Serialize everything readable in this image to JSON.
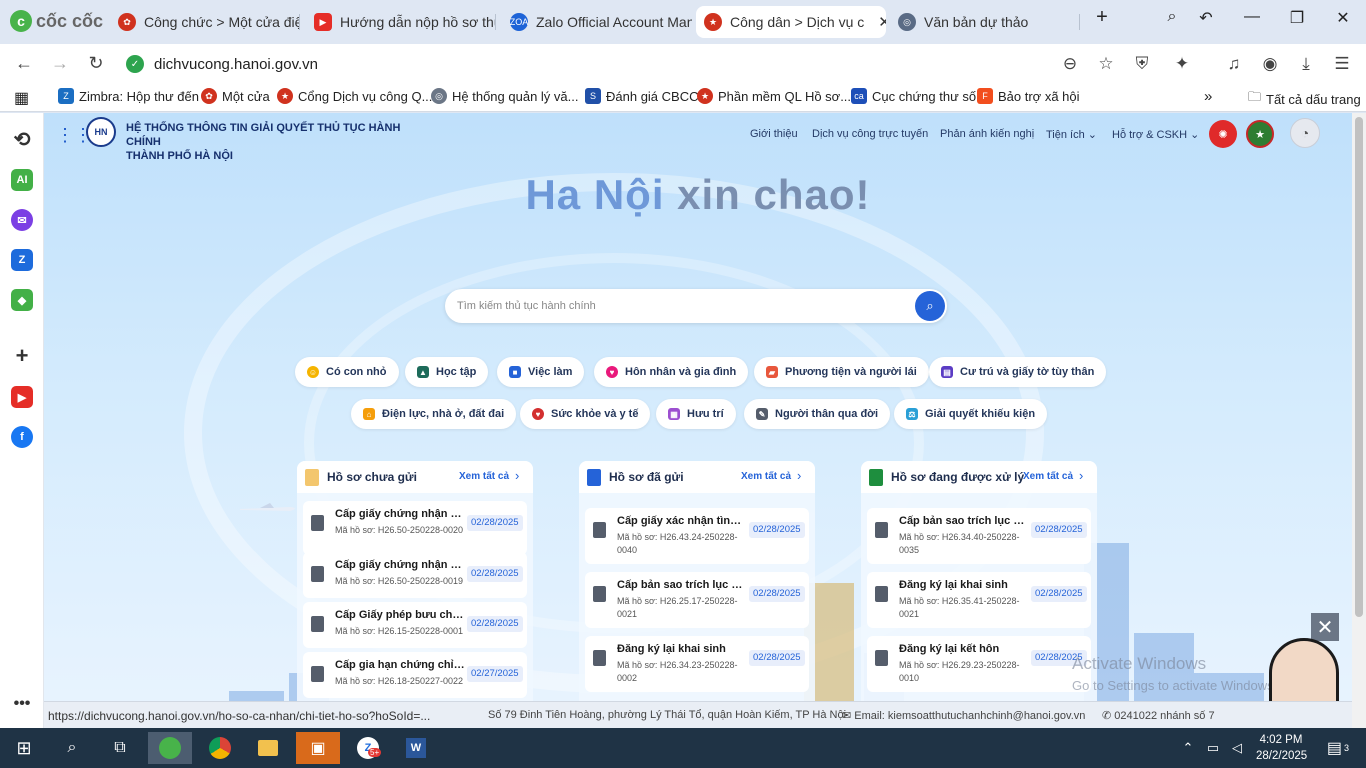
{
  "browser": {
    "brand": "cốc cốc",
    "tabs": [
      {
        "label": "Công chức > Một cửa điện",
        "fav": "hexagon-icon",
        "color": "#d0321e"
      },
      {
        "label": "Hướng dẫn nộp hồ sơ thủ",
        "fav": "youtube-icon",
        "color": "#e52d27"
      },
      {
        "label": "Zalo Official Account Mana",
        "fav": "zalo-oa-icon",
        "color": "#1d63d7"
      },
      {
        "label": "Công dân > Dịch vụ c",
        "fav": "national-emblem-icon",
        "color": "#d0321e",
        "active": true
      },
      {
        "label": "Văn bản dự thảo",
        "fav": "globe-icon",
        "color": "#5a6b85"
      }
    ],
    "url": "dichvucong.hanoi.gov.vn",
    "bookmarks": [
      "Zimbra: Hộp thư đến",
      "Một cửa",
      "Cổng Dịch vụ công Q...",
      "Hệ thống quản lý vă...",
      "Đánh giá CBCC",
      "Phần mềm QL Hồ sơ...",
      "Cục chứng thư số",
      "Bảo trợ xã hội"
    ],
    "all_bookmarks": "Tất cả dấu trang",
    "status_url": "https://dichvucong.hanoi.gov.vn/ho-so-ca-nhan/chi-tiet-ho-so?hoSoId=..."
  },
  "site": {
    "system_name_line1": "HỆ THỐNG THÔNG TIN GIẢI QUYẾT THỦ TỤC HÀNH CHÍNH",
    "system_name_line2": "THÀNH PHỐ HÀ NỘI",
    "nav": [
      "Giới thiệu",
      "Dịch vụ công trực tuyến",
      "Phản ánh kiến nghị",
      "Tiện ích",
      "Hỗ trợ & CSKH"
    ],
    "greeting_city": "Ha Nội",
    "greeting_rest": " xin chao!",
    "search_placeholder": "Tìm kiếm thủ tục hành chính",
    "categories_row1": [
      "Có con nhỏ",
      "Học tập",
      "Việc làm",
      "Hôn nhân và gia đình",
      "Phương tiện và người lái",
      "Cư trú và giấy tờ tùy thân"
    ],
    "categories_row2": [
      "Điện lực, nhà ở, đất đai",
      "Sức khỏe và y tế",
      "Hưu trí",
      "Người thân qua đời",
      "Giải quyết khiếu kiện"
    ],
    "view_all": "Xem tất cả",
    "cards": [
      {
        "title": "Hồ sơ chưa gửi",
        "items": [
          {
            "name": "Cấp giấy chứng nhận cơ s...",
            "code": "Mã hồ sơ: H26.50-250228-0020",
            "date": "02/28/2025"
          },
          {
            "name": "Cấp giấy chứng nhận cơ s...",
            "code": "Mã hồ sơ: H26.50-250228-0019",
            "date": "02/28/2025"
          },
          {
            "name": "Cấp Giấy phép bưu chính",
            "code": "Mã hồ sơ: H26.15-250228-0001",
            "date": "02/28/2025"
          },
          {
            "name": "Cấp gia hạn chứng chỉ hàn...",
            "code": "Mã hồ sơ: H26.18-250227-0022",
            "date": "02/27/2025"
          }
        ]
      },
      {
        "title": "Hồ sơ đã gửi",
        "items": [
          {
            "name": "Cấp giấy xác nhận tình trạ...",
            "code": "Mã hồ sơ: H26.43.24-250228-0040",
            "date": "02/28/2025"
          },
          {
            "name": "Cấp bản sao trích lục hộ tị...",
            "code": "Mã hồ sơ: H26.25.17-250228-0021",
            "date": "02/28/2025"
          },
          {
            "name": "Đăng ký lại khai sinh",
            "code": "Mã hồ sơ: H26.34.23-250228-0002",
            "date": "02/28/2025"
          }
        ]
      },
      {
        "title": "Hồ sơ đang được xử lý",
        "items": [
          {
            "name": "Cấp bản sao trích lục hộ tị...",
            "code": "Mã hồ sơ: H26.34.40-250228-0035",
            "date": "02/28/2025"
          },
          {
            "name": "Đăng ký lại khai sinh",
            "code": "Mã hồ sơ: H26.35.41-250228-0021",
            "date": "02/28/2025"
          },
          {
            "name": "Đăng ký lại kết hôn",
            "code": "Mã hồ sơ: H26.29.23-250228-0010",
            "date": "02/28/2025"
          }
        ]
      }
    ],
    "footer_address": "Số 79 Đinh Tiên Hoàng, phường Lý Thái Tổ, quận Hoàn Kiếm, TP Hà Nội",
    "footer_email": "Email: kiemsoatthutuchanhchinh@hanoi.gov.vn",
    "footer_phone": "0241022 nhánh số 7",
    "activate_title": "Activate Windows",
    "activate_sub": "Go to Settings to activate Windows."
  },
  "taskbar": {
    "time": "4:02 PM",
    "date": "28/2/2025",
    "badge": "5+",
    "notifications": "3"
  }
}
